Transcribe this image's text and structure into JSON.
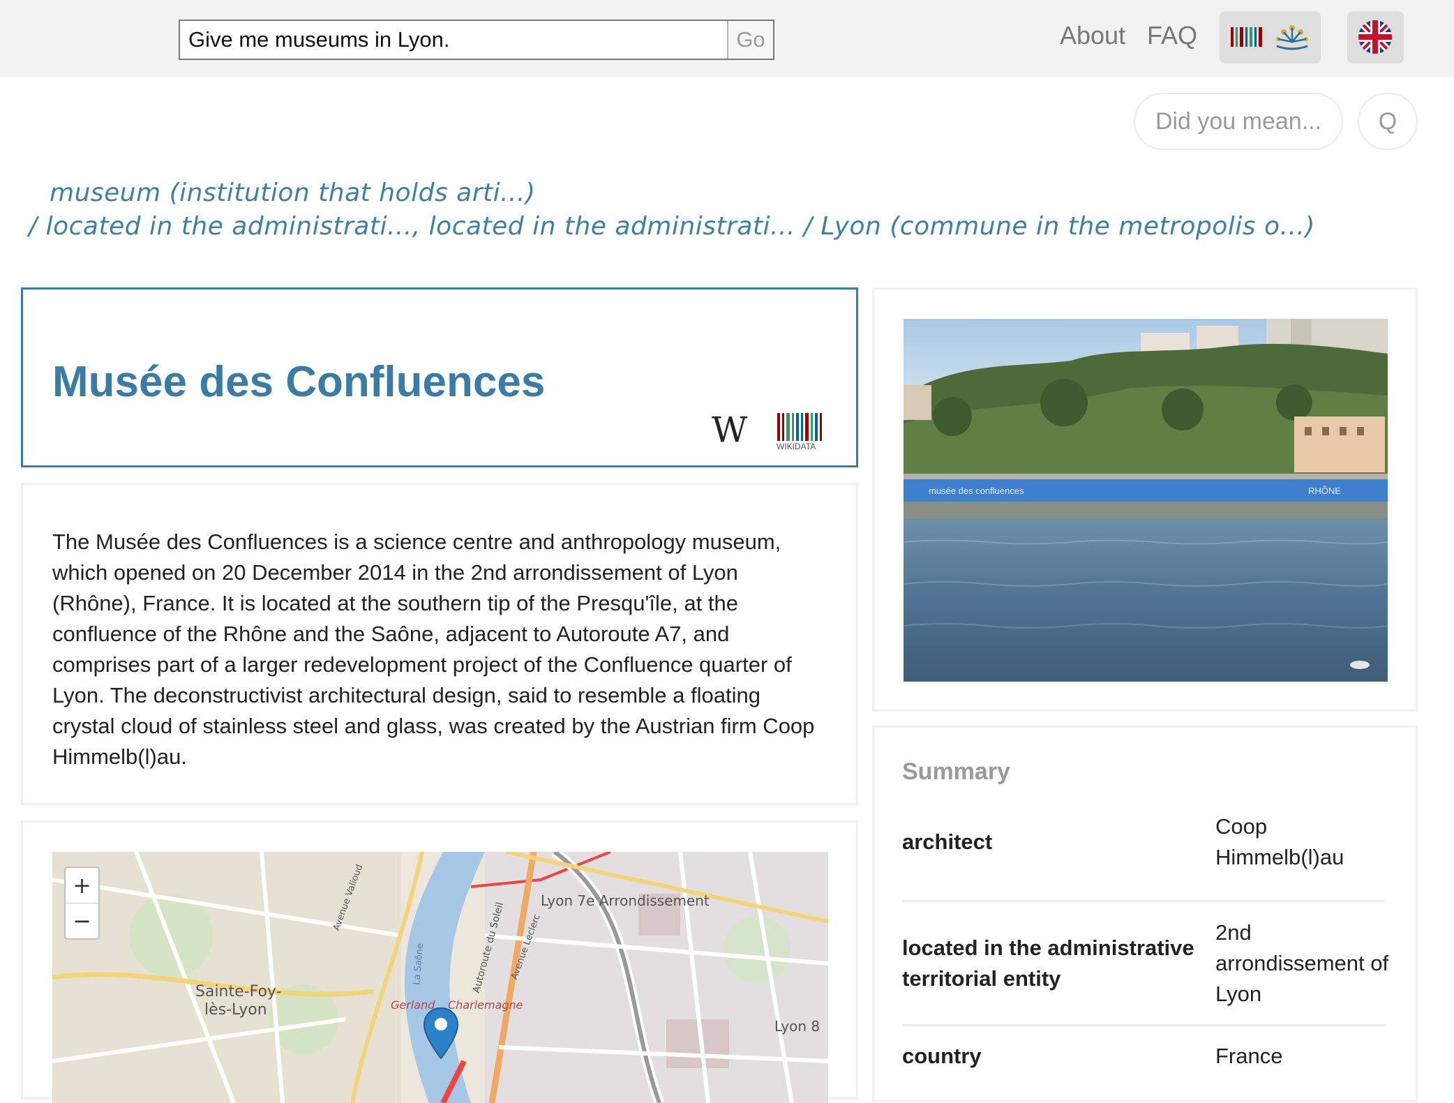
{
  "header": {
    "search_value": "Give me museums in Lyon.",
    "go_label": "Go",
    "nav": {
      "about": "About",
      "faq": "FAQ"
    },
    "kb_icon": "wikidata-kb-icon",
    "language_icon": "uk-flag-icon"
  },
  "suggest": {
    "did_you_mean": "Did you mean...",
    "q_label": "Q"
  },
  "interpretation": {
    "line1": "museum (institution that holds arti...)",
    "line2": "/ located in the administrati..., located in the administrati... / Lyon (commune in the metropolis o...)"
  },
  "result": {
    "title": "Musée des Confluences",
    "wikipedia_glyph": "W",
    "wikidata_label": "WIKIDATA",
    "description": "The Musée des Confluences is a science centre and anthropolo​gy museum, which opened on 20 December 2014 in the 2nd arrondissemen​t of Lyon (Rhône), France. It is located at the southern tip of the Presqu'îl​e, at the confluence of the Rhône and the Saône, adjacent to Autoroute A7, and comprises part of a larger redevelopment project of the Confluence quarter of Lyon. The deconstructivist architectural design, said to resemble a floating crystal cloud of stainless steel and glass, was created by the Austrian firm Coop Himmelb(l)au."
  },
  "photo": {
    "banner_left": "musée des confluences",
    "banner_right": "RHÔNE"
  },
  "summary": {
    "title": "Summary",
    "rows": [
      {
        "key": "architect",
        "value": "Coop Himmelb(l)au"
      },
      {
        "key": "located in the administrative territorial entity",
        "value": "2nd arrondissement of Lyon"
      },
      {
        "key": "country",
        "value": "France"
      }
    ]
  },
  "map": {
    "zoom_in": "+",
    "zoom_out": "−",
    "labels": {
      "arrondissement": "Lyon 7e Arrondissement",
      "suburb_1": "Sainte-Foy-",
      "suburb_2": "lès-Lyon",
      "gerland": "Gerland",
      "charlemagne": "Charlemagne",
      "lyon8": "Lyon 8",
      "vaulon": "Avenue Valioud",
      "soleil": "Autoroute du Soleil",
      "leclerc": "Avenue Leclerc",
      "saone": "La Saône"
    }
  }
}
